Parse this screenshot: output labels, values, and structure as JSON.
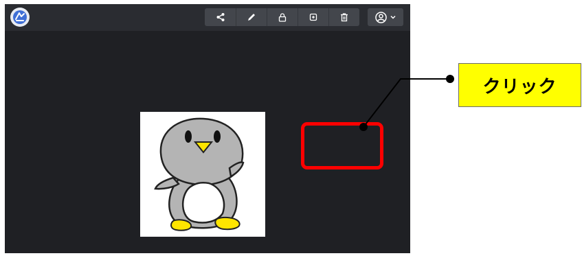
{
  "app": {
    "logo_icon": "app-logo-icon",
    "background_color": "#1f2024",
    "toolbar_color": "#43464c"
  },
  "toolbar": {
    "buttons": [
      {
        "icon": "share-icon",
        "label": "share"
      },
      {
        "icon": "pencil-icon",
        "label": "edit"
      },
      {
        "icon": "lock-icon",
        "label": "lock"
      },
      {
        "icon": "duplicate-icon",
        "label": "duplicate"
      },
      {
        "icon": "trash-icon",
        "label": "delete"
      }
    ],
    "account_icon": "user-circle-icon",
    "account_chevron": "chevron-down-icon"
  },
  "content": {
    "image_subject": "penguin-illustration"
  },
  "annotation": {
    "callout_text": "クリック",
    "highlight_color": "#ff0000",
    "callout_bg": "#ffff00"
  }
}
